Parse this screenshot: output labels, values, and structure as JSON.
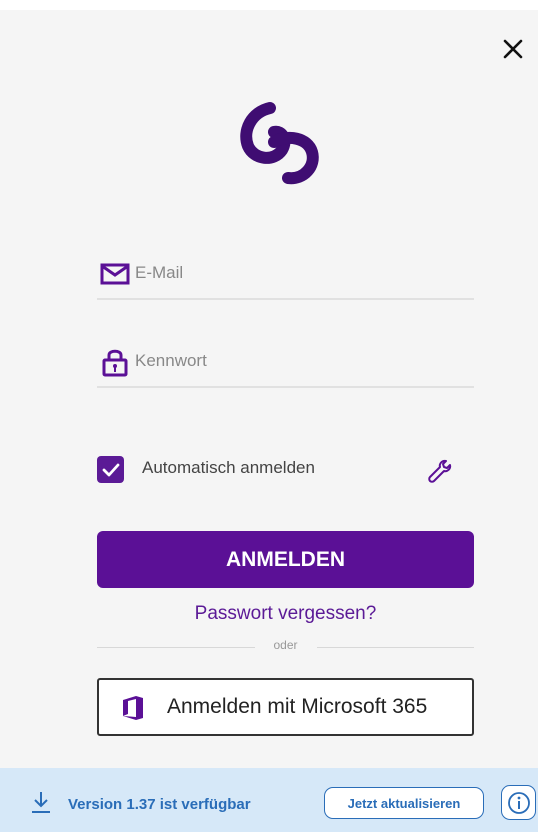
{
  "login": {
    "email_placeholder": "E-Mail",
    "password_placeholder": "Kennwort",
    "auto_login_label": "Automatisch anmelden",
    "auto_login_checked": true,
    "login_button": "ANMELDEN",
    "forgot_password": "Passwort vergessen?",
    "divider_text": "oder",
    "microsoft_button": "Anmelden mit Microsoft 365"
  },
  "update": {
    "version_text": "Version 1.37  ist verfügbar",
    "update_button": "Jetzt aktualisieren"
  },
  "colors": {
    "brand": "#5b1096",
    "update_accent": "#2a6db8",
    "update_bg": "#d6e8f8"
  },
  "icons": [
    "close-icon",
    "app-logo",
    "mail-icon",
    "lock-icon",
    "checkmark-icon",
    "wrench-icon",
    "office-icon",
    "download-icon",
    "info-icon"
  ]
}
